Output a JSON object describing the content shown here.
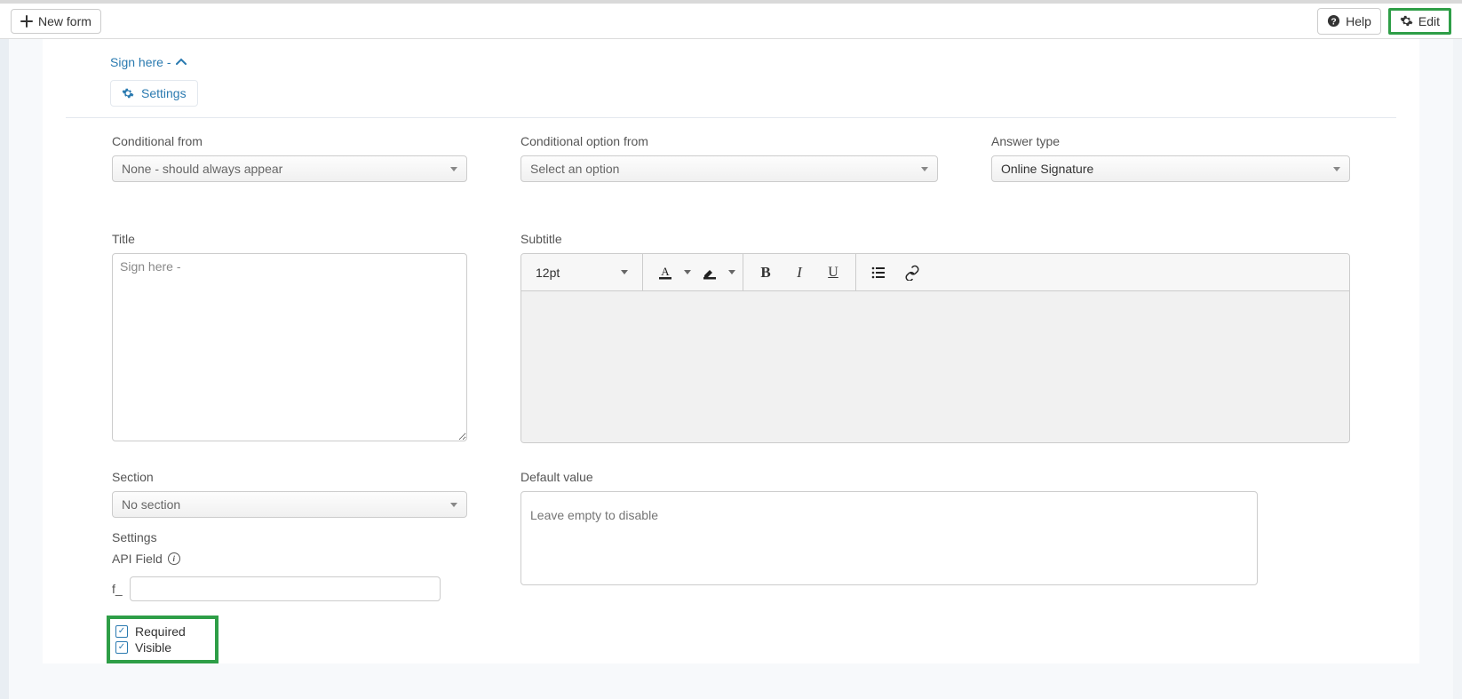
{
  "topbar": {
    "new_form": "New form",
    "help": "Help",
    "edit": "Edit"
  },
  "header": {
    "breadcrumb": "Sign here -",
    "settings_btn": "Settings"
  },
  "fields": {
    "conditional_from": {
      "label": "Conditional from",
      "value": "None - should always appear"
    },
    "conditional_option": {
      "label": "Conditional option from",
      "value": "Select an option"
    },
    "answer_type": {
      "label": "Answer type",
      "value": "Online Signature"
    },
    "title": {
      "label": "Title",
      "value": "Sign here -"
    },
    "subtitle": {
      "label": "Subtitle"
    },
    "section": {
      "label": "Section",
      "value": "No section"
    },
    "settings_label": "Settings",
    "api_field_label": "API Field",
    "api_prefix": "f_",
    "required_label": "Required",
    "visible_label": "Visible",
    "default_value": {
      "label": "Default value",
      "placeholder": "Leave empty to disable"
    }
  },
  "editor": {
    "font_size": "12pt"
  }
}
